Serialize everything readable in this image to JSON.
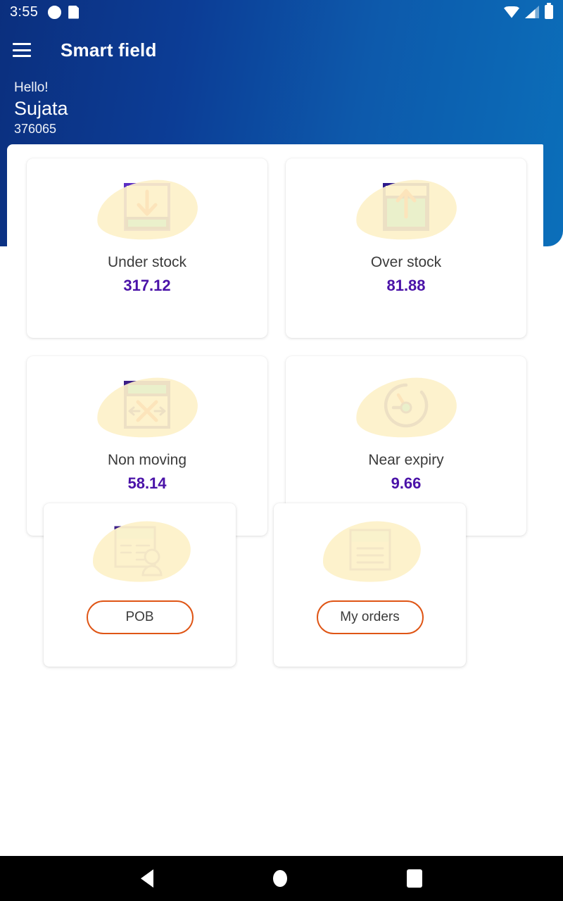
{
  "status_bar": {
    "time": "3:55",
    "left_icons": [
      "contrast-icon",
      "sd-card-icon"
    ],
    "right_icons": [
      "wifi-icon",
      "cellular-signal-icon",
      "battery-icon"
    ]
  },
  "header": {
    "menu_icon": "hamburger-menu-icon",
    "title": "Smart field",
    "greeting": "Hello!",
    "user_name": "Sujata",
    "user_code": "376065",
    "gradient_from": "#0b2f7e",
    "gradient_to": "#0b6fba"
  },
  "stats": [
    {
      "label": "Under stock",
      "value": "317.12",
      "icon": "under-stock-icon"
    },
    {
      "label": "Over stock",
      "value": "81.88",
      "icon": "over-stock-icon"
    },
    {
      "label": "Non moving",
      "value": "58.14",
      "icon": "non-moving-icon"
    },
    {
      "label": "Near expiry",
      "value": "9.66",
      "icon": "near-expiry-icon"
    }
  ],
  "actions": [
    {
      "label": "POB",
      "icon": "pob-document-person-icon"
    },
    {
      "label": "My orders",
      "icon": "my-orders-document-icon"
    }
  ],
  "colors": {
    "value_purple": "#4a12a8",
    "label_gray": "#3b3b3b",
    "accent_orange": "#df5515",
    "icon_purple": "#3b1e87",
    "icon_cyan": "#18dede",
    "blob_yellow": "#fdf1c9"
  },
  "navbar": {
    "back": "back-triangle-icon",
    "home": "home-circle-icon",
    "recents": "recents-square-icon"
  }
}
